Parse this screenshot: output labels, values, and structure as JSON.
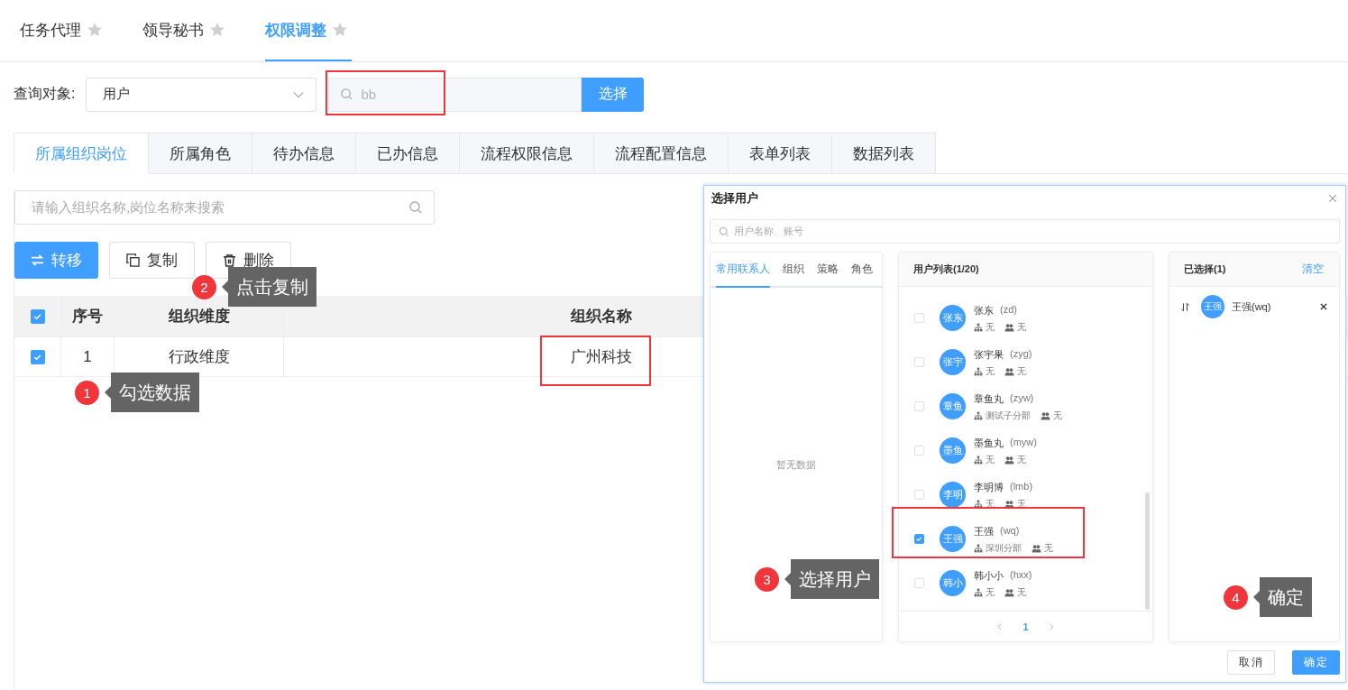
{
  "top_tabs": [
    {
      "label": "任务代理",
      "selected": false
    },
    {
      "label": "领导秘书",
      "selected": false
    },
    {
      "label": "权限调整",
      "selected": true
    }
  ],
  "query": {
    "label": "查询对象:",
    "select_value": "用户",
    "search_value": "bb",
    "search_disabled": true,
    "select_button": "选择"
  },
  "sub_tabs": [
    {
      "label": "所属组织岗位",
      "selected": true
    },
    {
      "label": "所属角色",
      "selected": false
    },
    {
      "label": "待办信息",
      "selected": false
    },
    {
      "label": "已办信息",
      "selected": false
    },
    {
      "label": "流程权限信息",
      "selected": false
    },
    {
      "label": "流程配置信息",
      "selected": false
    },
    {
      "label": "表单列表",
      "selected": false
    },
    {
      "label": "数据列表",
      "selected": false
    }
  ],
  "org_search": {
    "placeholder": "请输入组织名称,岗位名称来搜索"
  },
  "actions": [
    {
      "label": "转移",
      "kind": "transfer"
    },
    {
      "label": "复制",
      "kind": "copy"
    },
    {
      "label": "删除",
      "kind": "delete"
    }
  ],
  "table": {
    "all_checked": true,
    "columns": [
      "序号",
      "组织维度",
      "组织名称"
    ],
    "rows": [
      {
        "checked": true,
        "cells": [
          "1",
          "行政维度",
          "广州科技"
        ]
      }
    ]
  },
  "dialog": {
    "title": "选择用户",
    "search_placeholder": "用户名称、账号",
    "source_tabs": [
      {
        "label": "常用联系人",
        "selected": true
      },
      {
        "label": "组织",
        "selected": false
      },
      {
        "label": "策略",
        "selected": false
      },
      {
        "label": "角色",
        "selected": false
      }
    ],
    "empty_text": "暂无数据",
    "list_title": "用户列表(1/20)",
    "users": [
      {
        "avatar": "张东",
        "name": "张东",
        "account": "(zd)",
        "org": "无",
        "role": "无",
        "checked": false
      },
      {
        "avatar": "张宇",
        "name": "张宇果",
        "account": "(zyg)",
        "org": "无",
        "role": "无",
        "checked": false
      },
      {
        "avatar": "章鱼",
        "name": "章鱼丸",
        "account": "(zyw)",
        "org": "测试子分部",
        "role": "无",
        "checked": false
      },
      {
        "avatar": "墨鱼",
        "name": "墨鱼丸",
        "account": "(myw)",
        "org": "无",
        "role": "无",
        "checked": false
      },
      {
        "avatar": "李明",
        "name": "李明博",
        "account": "(lmb)",
        "org": "无",
        "role": "无",
        "checked": false
      },
      {
        "avatar": "王强",
        "name": "王强",
        "account": "(wq)",
        "org": "深圳分部",
        "role": "无",
        "checked": true
      },
      {
        "avatar": "韩小",
        "name": "韩小小",
        "account": "(hxx)",
        "org": "无",
        "role": "无",
        "checked": false
      }
    ],
    "page": "1",
    "selected_title": "已选择(1)",
    "clear": "清空",
    "selected_users": [
      {
        "avatar": "王强",
        "label": "王强(wq)"
      }
    ],
    "buttons": [
      {
        "label": "取消",
        "kind": "default"
      },
      {
        "label": "确定",
        "kind": "primary"
      }
    ]
  },
  "callouts": [
    {
      "number": "1",
      "text": "勾选数据"
    },
    {
      "number": "2",
      "text": "点击复制"
    },
    {
      "number": "3",
      "text": "选择用户"
    },
    {
      "number": "4",
      "text": "确定"
    }
  ]
}
